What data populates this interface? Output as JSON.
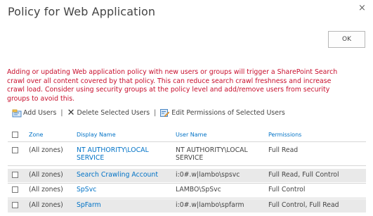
{
  "dialog": {
    "title": "Policy for Web Application",
    "close_glyph": "×"
  },
  "ok_label": "OK",
  "warning": "Adding or updating Web application policy with new users or groups will trigger a SharePoint Search crawl over all content covered by that policy. This can reduce search crawl freshness and increase crawl load. Consider using security groups at the policy level and add/remove users from security groups to avoid this.",
  "toolbar": {
    "add_users": "Add Users",
    "delete_selected": "Delete Selected Users",
    "edit_permissions": "Edit Permissions of Selected Users",
    "separator": "|"
  },
  "table": {
    "headers": {
      "zone": "Zone",
      "display_name": "Display Name",
      "user_name": "User Name",
      "permissions": "Permissions"
    },
    "rows": [
      {
        "zone": "(All zones)",
        "display_name": [
          "NT AUTHORITY\\LOCAL",
          "SERVICE"
        ],
        "user_name": [
          "NT AUTHORITY\\LOCAL",
          "SERVICE"
        ],
        "permissions": "Full Read"
      },
      {
        "zone": "(All zones)",
        "display_name": [
          "Search Crawling Account"
        ],
        "user_name": [
          "i:0#.w|lambo\\spsvc"
        ],
        "permissions": "Full Read, Full Control"
      },
      {
        "zone": "(All zones)",
        "display_name": [
          "SpSvc"
        ],
        "user_name": [
          "LAMBO\\SpSvc"
        ],
        "permissions": "Full Control"
      },
      {
        "zone": "(All zones)",
        "display_name": [
          "SpFarm"
        ],
        "user_name": [
          "i:0#.w|lambo\\spfarm"
        ],
        "permissions": "Full Control, Full Read"
      }
    ]
  },
  "colors": {
    "link": "#0072c6",
    "warning": "#c8102e",
    "text": "#444444",
    "row_highlight": "#e9e9e9"
  },
  "icons": {
    "add_users": "add-users-icon",
    "delete": "delete-x-icon",
    "edit_permissions": "edit-permissions-icon"
  }
}
